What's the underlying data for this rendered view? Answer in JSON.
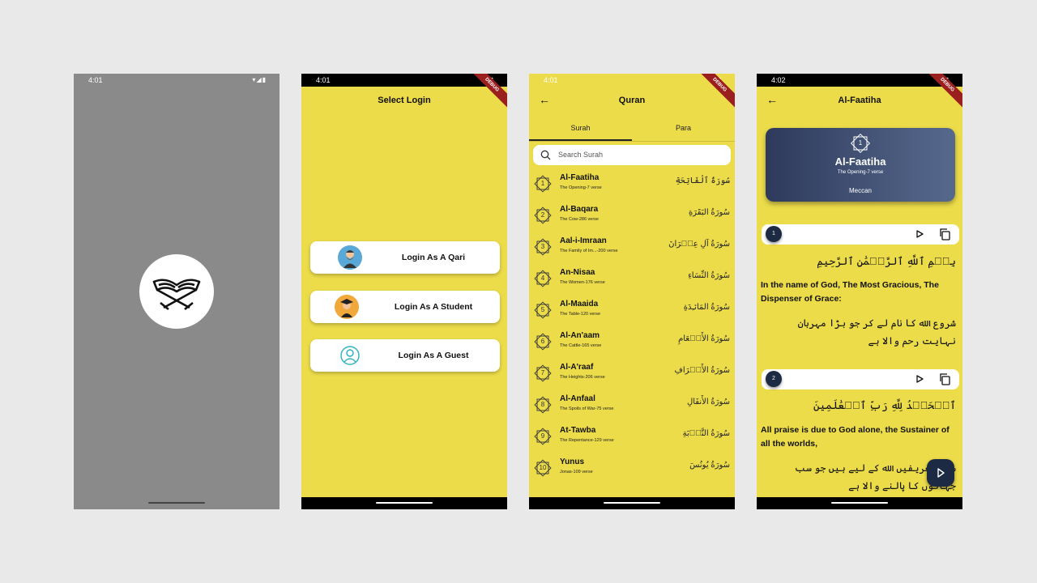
{
  "status": {
    "time1": "4:01",
    "time2": "4:01",
    "time3": "4:01",
    "time4": "4:02"
  },
  "debug_label": "DEBUG",
  "login": {
    "title": "Select Login",
    "buttons": [
      {
        "label": "Login As A Qari",
        "icon": "qari-avatar-icon"
      },
      {
        "label": "Login As A Student",
        "icon": "student-avatar-icon"
      },
      {
        "label": "Login As A Guest",
        "icon": "guest-user-icon"
      }
    ]
  },
  "quran": {
    "title": "Quran",
    "tabs": [
      "Surah",
      "Para"
    ],
    "search_placeholder": "Search Surah",
    "surahs": [
      {
        "num": "1",
        "name": "Al-Faatiha",
        "sub": "The Opening-7 verse",
        "ar": "سُورَةُ ٱلْفَاتِحَةِ"
      },
      {
        "num": "2",
        "name": "Al-Baqara",
        "sub": "The Cow-286 verse",
        "ar": "سُورَةُ البَقَرَةِ"
      },
      {
        "num": "3",
        "name": "Aal-i-Imraan",
        "sub": "The Family of Im...-200 verse",
        "ar": "سُورَةُ آلِ عِمۡرَانَ"
      },
      {
        "num": "4",
        "name": "An-Nisaa",
        "sub": "The Women-176 verse",
        "ar": "سُورَةُ النِّسَاءِ"
      },
      {
        "num": "5",
        "name": "Al-Maaida",
        "sub": "The Table-120 verse",
        "ar": "سُورَةُ المَائـِدَةِ"
      },
      {
        "num": "6",
        "name": "Al-An'aam",
        "sub": "The Cattle-165 verse",
        "ar": "سُورَةُ الأَنۡعَامِ"
      },
      {
        "num": "7",
        "name": "Al-A'raaf",
        "sub": "The Heights-206 verse",
        "ar": "سُورَةُ الأَعۡرَافِ"
      },
      {
        "num": "8",
        "name": "Al-Anfaal",
        "sub": "The Spoils of War-75 verse",
        "ar": "سُورَةُ الأَنفَالِ"
      },
      {
        "num": "9",
        "name": "At-Tawba",
        "sub": "The Repentance-129 verse",
        "ar": "سُورَةُ التَّوۡبَةِ"
      },
      {
        "num": "10",
        "name": "Yunus",
        "sub": "Jonas-109 verse",
        "ar": "سُورَةُ يُونُسَ"
      }
    ]
  },
  "detail": {
    "title": "Al-Faatiha",
    "card": {
      "num": "1",
      "name": "Al-Faatiha",
      "sub": "The Opening-7 verse",
      "place": "Meccan"
    },
    "verses": [
      {
        "num": "1",
        "arabic": "بِسۡمِ ٱللَّهِ ٱلرَّحۡمَٰنِ ٱلرَّحِيمِ",
        "english": "In the name of God, The Most Gracious, The Dispenser of Grace:",
        "urdu": "شروع الله کا نام لے کر جو بڑا مہربان نہایت رحم والا ہے"
      },
      {
        "num": "2",
        "arabic": "ٱلۡحَمۡدُ لِلَّهِ رَبِّ ٱلۡعَٰلَمِينَ",
        "english": "All praise is due to God alone, the Sustainer of all the worlds,",
        "urdu": "سب تعریفیں الله کے لیے ہیں جو سب جہانوں کا پالنے والا ہے"
      }
    ]
  },
  "colors": {
    "background": "#ecdc4a",
    "accent": "#1c2a44"
  }
}
